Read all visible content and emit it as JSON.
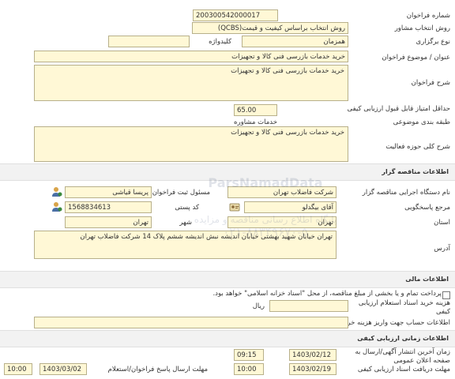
{
  "general": {
    "call_number_label": "شماره فراخوان",
    "call_number": "200300542000017",
    "consultant_method_label": "روش انتخاب مشاور",
    "consultant_method": "روش انتخاب براساس کیفیت و قیمت(QCBS)",
    "holding_type_label": "نوع برگزاری",
    "holding_type": "همزمان",
    "keyword_label": "کلیدواژه",
    "keyword": "",
    "title_label": "عنوان / موضوع فراخوان",
    "title": "خرید خدمات بازرسی فنی کالا و تجهیزات",
    "description_label": "شرح فراخوان",
    "description": "خرید خدمات بازرسی فنی کالا و تجهیزات",
    "min_score_label": "حداقل امتیاز قابل قبول ارزیابی کیفی",
    "min_score": "65.00",
    "category_label": "طبقه بندی موضوعی",
    "category": "خدمات مشاوره",
    "activity_label": "شرح کلی حوزه فعالیت",
    "activity": "خرید خدمات بازرسی فنی کالا و تجهیزات"
  },
  "organizer": {
    "section_title": "اطلاعات مناقصه گزار",
    "org_name_label": "نام دستگاه اجرایی مناقصه گزار",
    "org_name": "شرکت فاضلاب تهران",
    "registrar_label": "مسئول ثبت فراخوان",
    "registrar": "پریسا  قیاشی",
    "responder_label": "مرجع پاسخگویی",
    "responder": "آقای بیگدلو",
    "postal_code_label": "کد پستی",
    "postal_code": "1568834613",
    "province_label": "استان",
    "province": "تهران",
    "city_label": "شهر",
    "city": "تهران",
    "address_label": "آدرس",
    "address": "تهران خیابان شهید بهشتی خیابان اندیشه نبش اندیشه ششم پلاک 14 شرکت فاضلاب تهران"
  },
  "financial": {
    "section_title": "اطلاعات مالی",
    "payment_note": "پرداخت تمام و یا بخشی از مبلغ مناقصه، از محل \"اسناد خزانه اسلامی\" خواهد بود.",
    "doc_cost_label": "هزینه خرید اسناد استعلام ارزیابی کیفی",
    "doc_cost_value": "",
    "currency": "ریال",
    "account_label": "اطلاعات حساب جهت واریز هزینه خرید",
    "account_value": ""
  },
  "timing": {
    "section_title": "اطلاعات زمانی ارزیابی کیفی",
    "publish_label": "زمان آخرین انتشار آگهی/ارسال به صفحه اعلان عمومی",
    "publish_date": "1403/02/12",
    "publish_time": "09:15",
    "receive_label": "مهلت دریافت اسناد ارزیابی کیفی",
    "receive_date": "1403/02/19",
    "receive_time": "10:00",
    "send_label": "مهلت ارسال پاسخ فراخوان/استعلام",
    "send_date": "1403/03/02",
    "send_time": "10:00"
  },
  "watermark": {
    "phone": "۰۲۱-۸۸۳۴۹۶۷۰-۵",
    "site": "ParsNamadData",
    "text": "پایگاه اطلاع رسانی مناقصه و مزایده"
  },
  "icons": {
    "registrar": "user-icon",
    "responder": "user-icon",
    "responder_card": "contact-card-icon"
  }
}
